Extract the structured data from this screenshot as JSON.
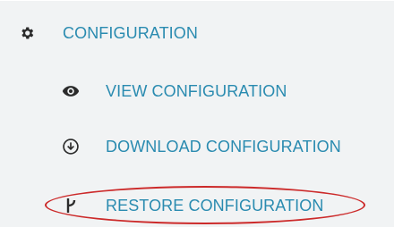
{
  "menu": {
    "header": {
      "label": "CONFIGURATION",
      "icon": "gear-icon"
    },
    "items": [
      {
        "label": "VIEW CONFIGURATION",
        "icon": "eye-icon"
      },
      {
        "label": "DOWNLOAD CONFIGURATION",
        "icon": "download-circle-icon"
      },
      {
        "label": "RESTORE CONFIGURATION",
        "icon": "restore-icon"
      }
    ]
  },
  "colors": {
    "link": "#2a8bb0",
    "icon": "#2b2b2b",
    "background": "#f1f3f4",
    "highlight": "#cc2a2a"
  }
}
